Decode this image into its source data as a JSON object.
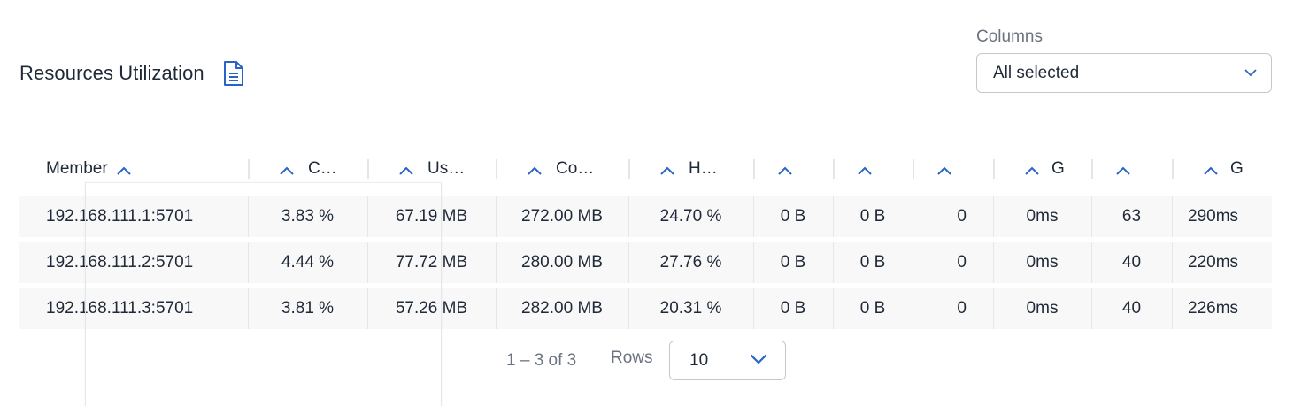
{
  "header": {
    "title": "Resources Utilization"
  },
  "columns_filter": {
    "label": "Columns",
    "value": "All selected"
  },
  "table": {
    "headers": [
      "Member",
      "C…",
      "Us…",
      "Co…",
      "H…",
      "",
      "",
      "",
      "G",
      "",
      "G"
    ],
    "rows": [
      [
        "192.168.111.1:5701",
        "3.83 %",
        "67.19 MB",
        "272.00 MB",
        "24.70 %",
        "0 B",
        "0 B",
        "0",
        "0ms",
        "63",
        "290ms"
      ],
      [
        "192.168.111.2:5701",
        "4.44 %",
        "77.72 MB",
        "280.00 MB",
        "27.76 %",
        "0 B",
        "0 B",
        "0",
        "0ms",
        "40",
        "220ms"
      ],
      [
        "192.168.111.3:5701",
        "3.81 %",
        "57.26 MB",
        "282.00 MB",
        "20.31 %",
        "0 B",
        "0 B",
        "0",
        "0ms",
        "40",
        "226ms"
      ]
    ]
  },
  "pagination": {
    "range": "1 – 3 of 3",
    "rows_label": "Rows",
    "rows_value": "10"
  },
  "colors": {
    "accent": "#2a64c5",
    "text": "#1f2937",
    "muted": "#6b7280"
  }
}
